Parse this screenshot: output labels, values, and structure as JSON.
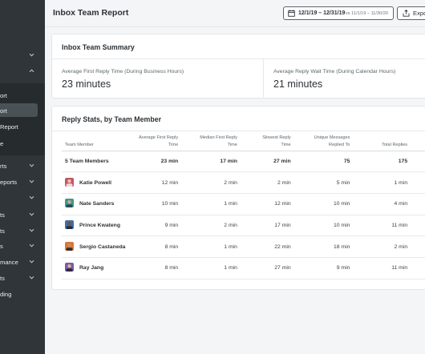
{
  "sidebar": {
    "items": [
      {
        "label": "",
        "chevron": "down"
      },
      {
        "label": "",
        "chevron": "up"
      },
      {
        "label": "ort",
        "chevron": null
      },
      {
        "label": "ort",
        "chevron": null
      },
      {
        "label": "Report",
        "chevron": null
      },
      {
        "label": "e",
        "chevron": null
      },
      {
        "label": "rts",
        "chevron": "down"
      },
      {
        "label": "eports",
        "chevron": "down"
      },
      {
        "label": "",
        "chevron": "down"
      },
      {
        "label": "ts",
        "chevron": "down"
      },
      {
        "label": "ts",
        "chevron": "down"
      },
      {
        "label": "s",
        "chevron": "down"
      },
      {
        "label": "mance",
        "chevron": "down"
      },
      {
        "label": "ts",
        "chevron": "down"
      },
      {
        "label": "ding",
        "chevron": null
      }
    ]
  },
  "header": {
    "title": "Inbox Team Report",
    "date_range": "12/1/19 – 12/31/19",
    "compare_range": "vs 11/1/19 – 11/30/20",
    "export_label": "Expo"
  },
  "summary": {
    "title": "Inbox Team Summary",
    "metrics": [
      {
        "label": "Average First Reply Time (During Business Hours)",
        "value": "23 minutes"
      },
      {
        "label": "Average Reply Wait Time (During Calendar Hours)",
        "value": "21 minutes"
      }
    ]
  },
  "stats": {
    "title": "Reply Stats, by Team Member",
    "columns": [
      {
        "line1": "",
        "line2": "Team Member"
      },
      {
        "line1": "Average First Reply",
        "line2": "Time"
      },
      {
        "line1": "Median First Reply",
        "line2": "Time"
      },
      {
        "line1": "Slowest Reply",
        "line2": "Time"
      },
      {
        "line1": "Unique Messages",
        "line2": "Replied To"
      },
      {
        "line1": "",
        "line2": "Total Replies"
      }
    ],
    "total": {
      "name": "5 Team Members",
      "avg": "23 min",
      "median": "17 min",
      "slowest": "27 min",
      "unique": "75",
      "total": "175"
    },
    "rows": [
      {
        "name": "Katie Powell",
        "avg": "12 min",
        "median": "2 min",
        "slowest": "2 min",
        "unique": "5 min",
        "total": "1 min",
        "avatar_color": "#c0566a"
      },
      {
        "name": "Nate Sanders",
        "avg": "10 min",
        "median": "1 min",
        "slowest": "12 min",
        "unique": "10 min",
        "total": "4 min",
        "avatar_color": "#3a9a8a"
      },
      {
        "name": "Prince Kwateng",
        "avg": "9 min",
        "median": "2 min",
        "slowest": "17 min",
        "unique": "10 min",
        "total": "11 min",
        "avatar_color": "#3d6fa8"
      },
      {
        "name": "Sergio Castaneda",
        "avg": "8 min",
        "median": "1 min",
        "slowest": "22 min",
        "unique": "18 min",
        "total": "2 min",
        "avatar_color": "#d9763a"
      },
      {
        "name": "Ray Jang",
        "avg": "8 min",
        "median": "1 min",
        "slowest": "27 min",
        "unique": "9 min",
        "total": "11 min",
        "avatar_color": "#7a5aa6"
      }
    ]
  },
  "colors": {
    "sidebar_bg": "#2f3538",
    "sidebar_active": "#4a5256",
    "page_bg": "#f4f5f6",
    "card_bg": "#ffffff",
    "text": "#2c3135"
  }
}
